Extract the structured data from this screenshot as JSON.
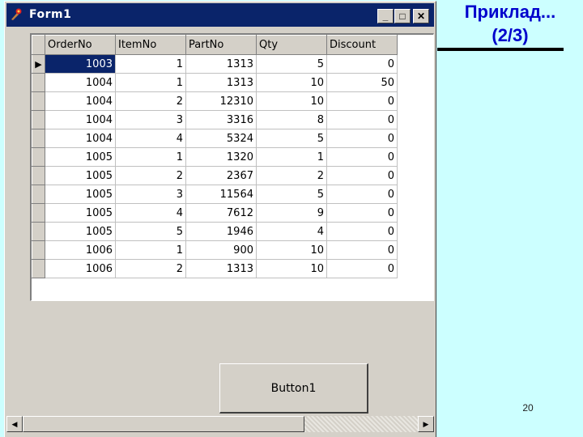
{
  "slide": {
    "title_line1": "Приклад...",
    "title_line2": "(2/3)",
    "page_number": "20"
  },
  "window": {
    "title": "Form1",
    "icon": "delphi-app-icon",
    "minimize_glyph": "_",
    "maximize_glyph": "□",
    "close_glyph": "✕"
  },
  "grid": {
    "columns": [
      "OrderNo",
      "ItemNo",
      "PartNo",
      "Qty",
      "Discount"
    ],
    "current_row_indicator": "▶",
    "selected_row": 0,
    "rows": [
      [
        "1003",
        "1",
        "1313",
        "5",
        "0"
      ],
      [
        "1004",
        "1",
        "1313",
        "10",
        "50"
      ],
      [
        "1004",
        "2",
        "12310",
        "10",
        "0"
      ],
      [
        "1004",
        "3",
        "3316",
        "8",
        "0"
      ],
      [
        "1004",
        "4",
        "5324",
        "5",
        "0"
      ],
      [
        "1005",
        "1",
        "1320",
        "1",
        "0"
      ],
      [
        "1005",
        "2",
        "2367",
        "2",
        "0"
      ],
      [
        "1005",
        "3",
        "11564",
        "5",
        "0"
      ],
      [
        "1005",
        "4",
        "7612",
        "9",
        "0"
      ],
      [
        "1005",
        "5",
        "1946",
        "4",
        "0"
      ],
      [
        "1006",
        "1",
        "900",
        "10",
        "0"
      ],
      [
        "1006",
        "2",
        "1313",
        "10",
        "0"
      ]
    ]
  },
  "button": {
    "label": "Button1"
  },
  "scrollbar": {
    "left_arrow": "◀",
    "right_arrow": "▶"
  },
  "colors": {
    "slide_background": "#ccffff",
    "title_text": "#0000cc",
    "window_face": "#d4d0c8",
    "titlebar": "#0a246a"
  }
}
